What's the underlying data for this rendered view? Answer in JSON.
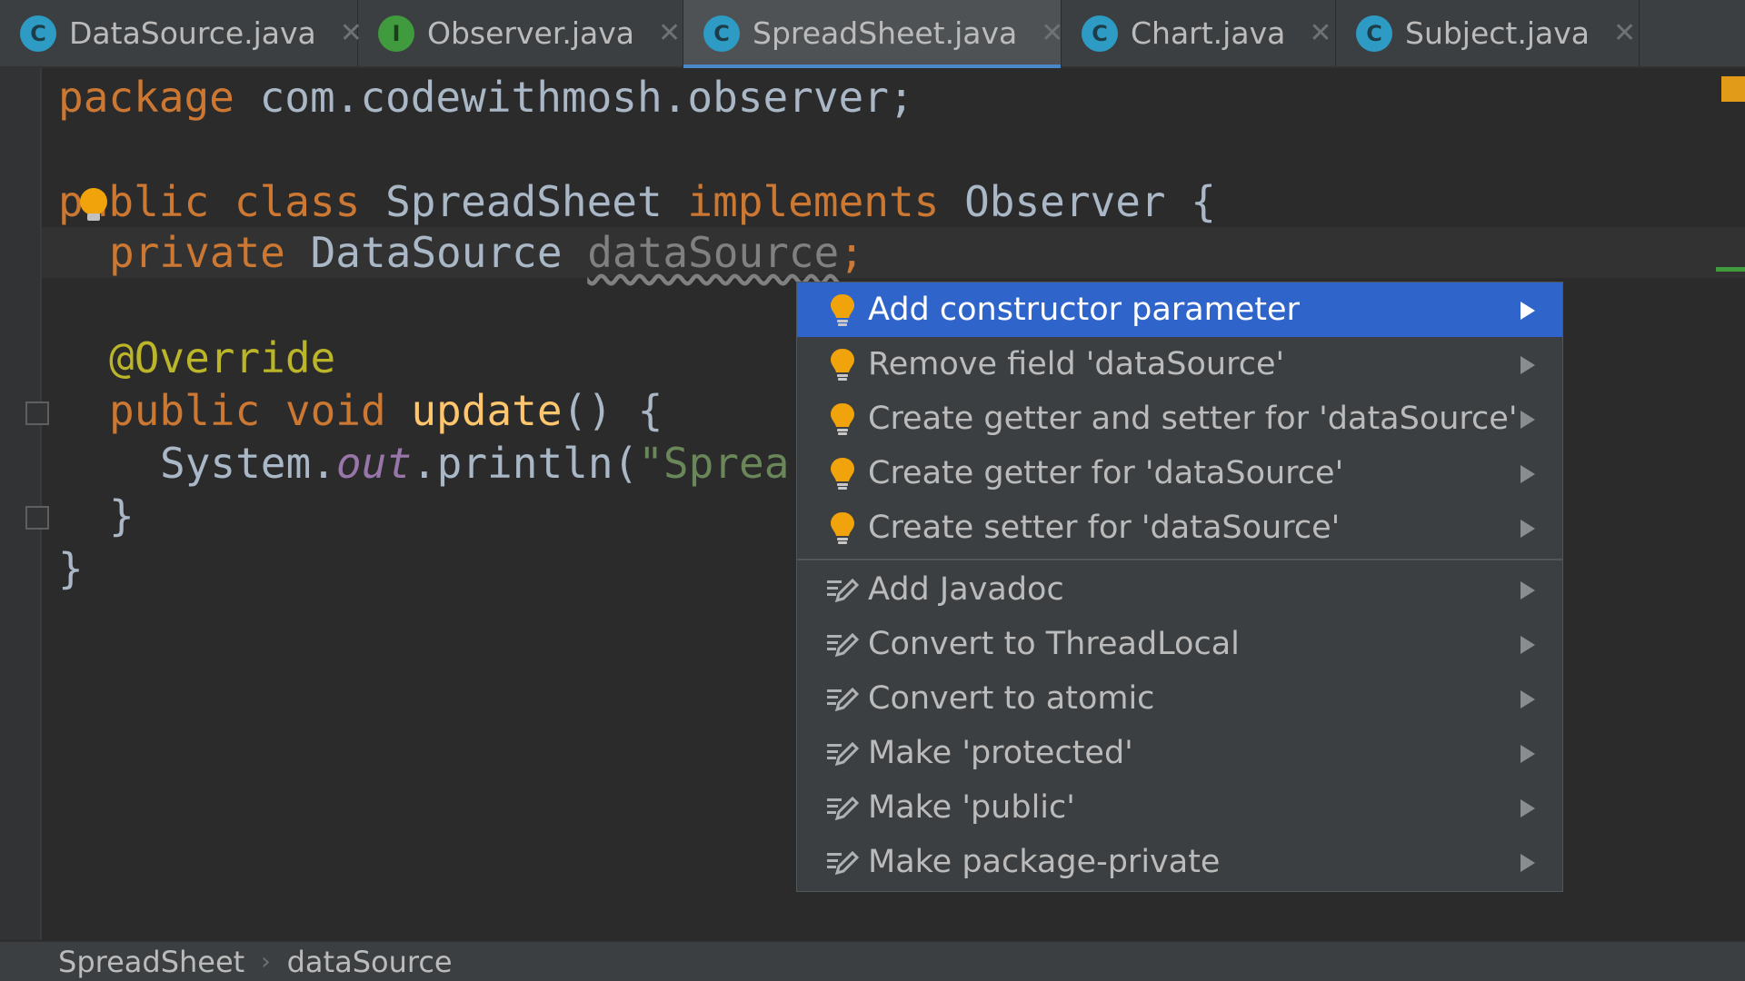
{
  "tabs": [
    {
      "label": "DataSource.java",
      "icon": "C",
      "kind": "class"
    },
    {
      "label": "Observer.java",
      "icon": "I",
      "kind": "interface"
    },
    {
      "label": "SpreadSheet.java",
      "icon": "C",
      "kind": "class",
      "active": true
    },
    {
      "label": "Chart.java",
      "icon": "C",
      "kind": "class"
    },
    {
      "label": "Subject.java",
      "icon": "C",
      "kind": "class"
    }
  ],
  "tab_close_glyph": "✕",
  "code": {
    "l1_kw": "package",
    "l1_rest": " com.codewithmosh.observer;",
    "l3_kw1": "public",
    "l3_kw2": "class",
    "l3_name": "SpreadSheet",
    "l3_kw3": "implements",
    "l3_iface": "Observer {",
    "l4_kw": "private",
    "l4_type": "DataSource",
    "l4_field": "dataSource",
    "l4_semi": ";",
    "l6_ann": "@Override",
    "l7_kw1": "public",
    "l7_kw2": "void",
    "l7_fn": "update",
    "l7_rest": "() {",
    "l8_a": "System.",
    "l8_b": "out",
    "l8_c": ".println(",
    "l8_d": "\"Sprea",
    "l9": "}",
    "l10": "}"
  },
  "menu": {
    "items": [
      {
        "label": "Add constructor parameter",
        "icon": "bulb-icon",
        "selected": true
      },
      {
        "label": "Remove field 'dataSource'",
        "icon": "bulb-icon"
      },
      {
        "label": "Create getter and setter for 'dataSource'",
        "icon": "bulb-icon"
      },
      {
        "label": "Create getter for 'dataSource'",
        "icon": "bulb-icon"
      },
      {
        "label": "Create setter for 'dataSource'",
        "icon": "bulb-icon"
      },
      {
        "label": "Add Javadoc",
        "icon": "edit-icon"
      },
      {
        "label": "Convert to ThreadLocal",
        "icon": "edit-icon"
      },
      {
        "label": "Convert to atomic",
        "icon": "edit-icon"
      },
      {
        "label": "Make 'protected'",
        "icon": "edit-icon"
      },
      {
        "label": "Make 'public'",
        "icon": "edit-icon"
      },
      {
        "label": "Make package-private",
        "icon": "edit-icon"
      }
    ]
  },
  "breadcrumb": {
    "class": "SpreadSheet",
    "field": "dataSource",
    "sep": "›"
  },
  "colors": {
    "accent": "#2f65ca",
    "keyword": "#cc7832",
    "annotation": "#bbb529",
    "function": "#ffc66d",
    "string": "#6a8759",
    "bulb": "#f0a30a"
  }
}
